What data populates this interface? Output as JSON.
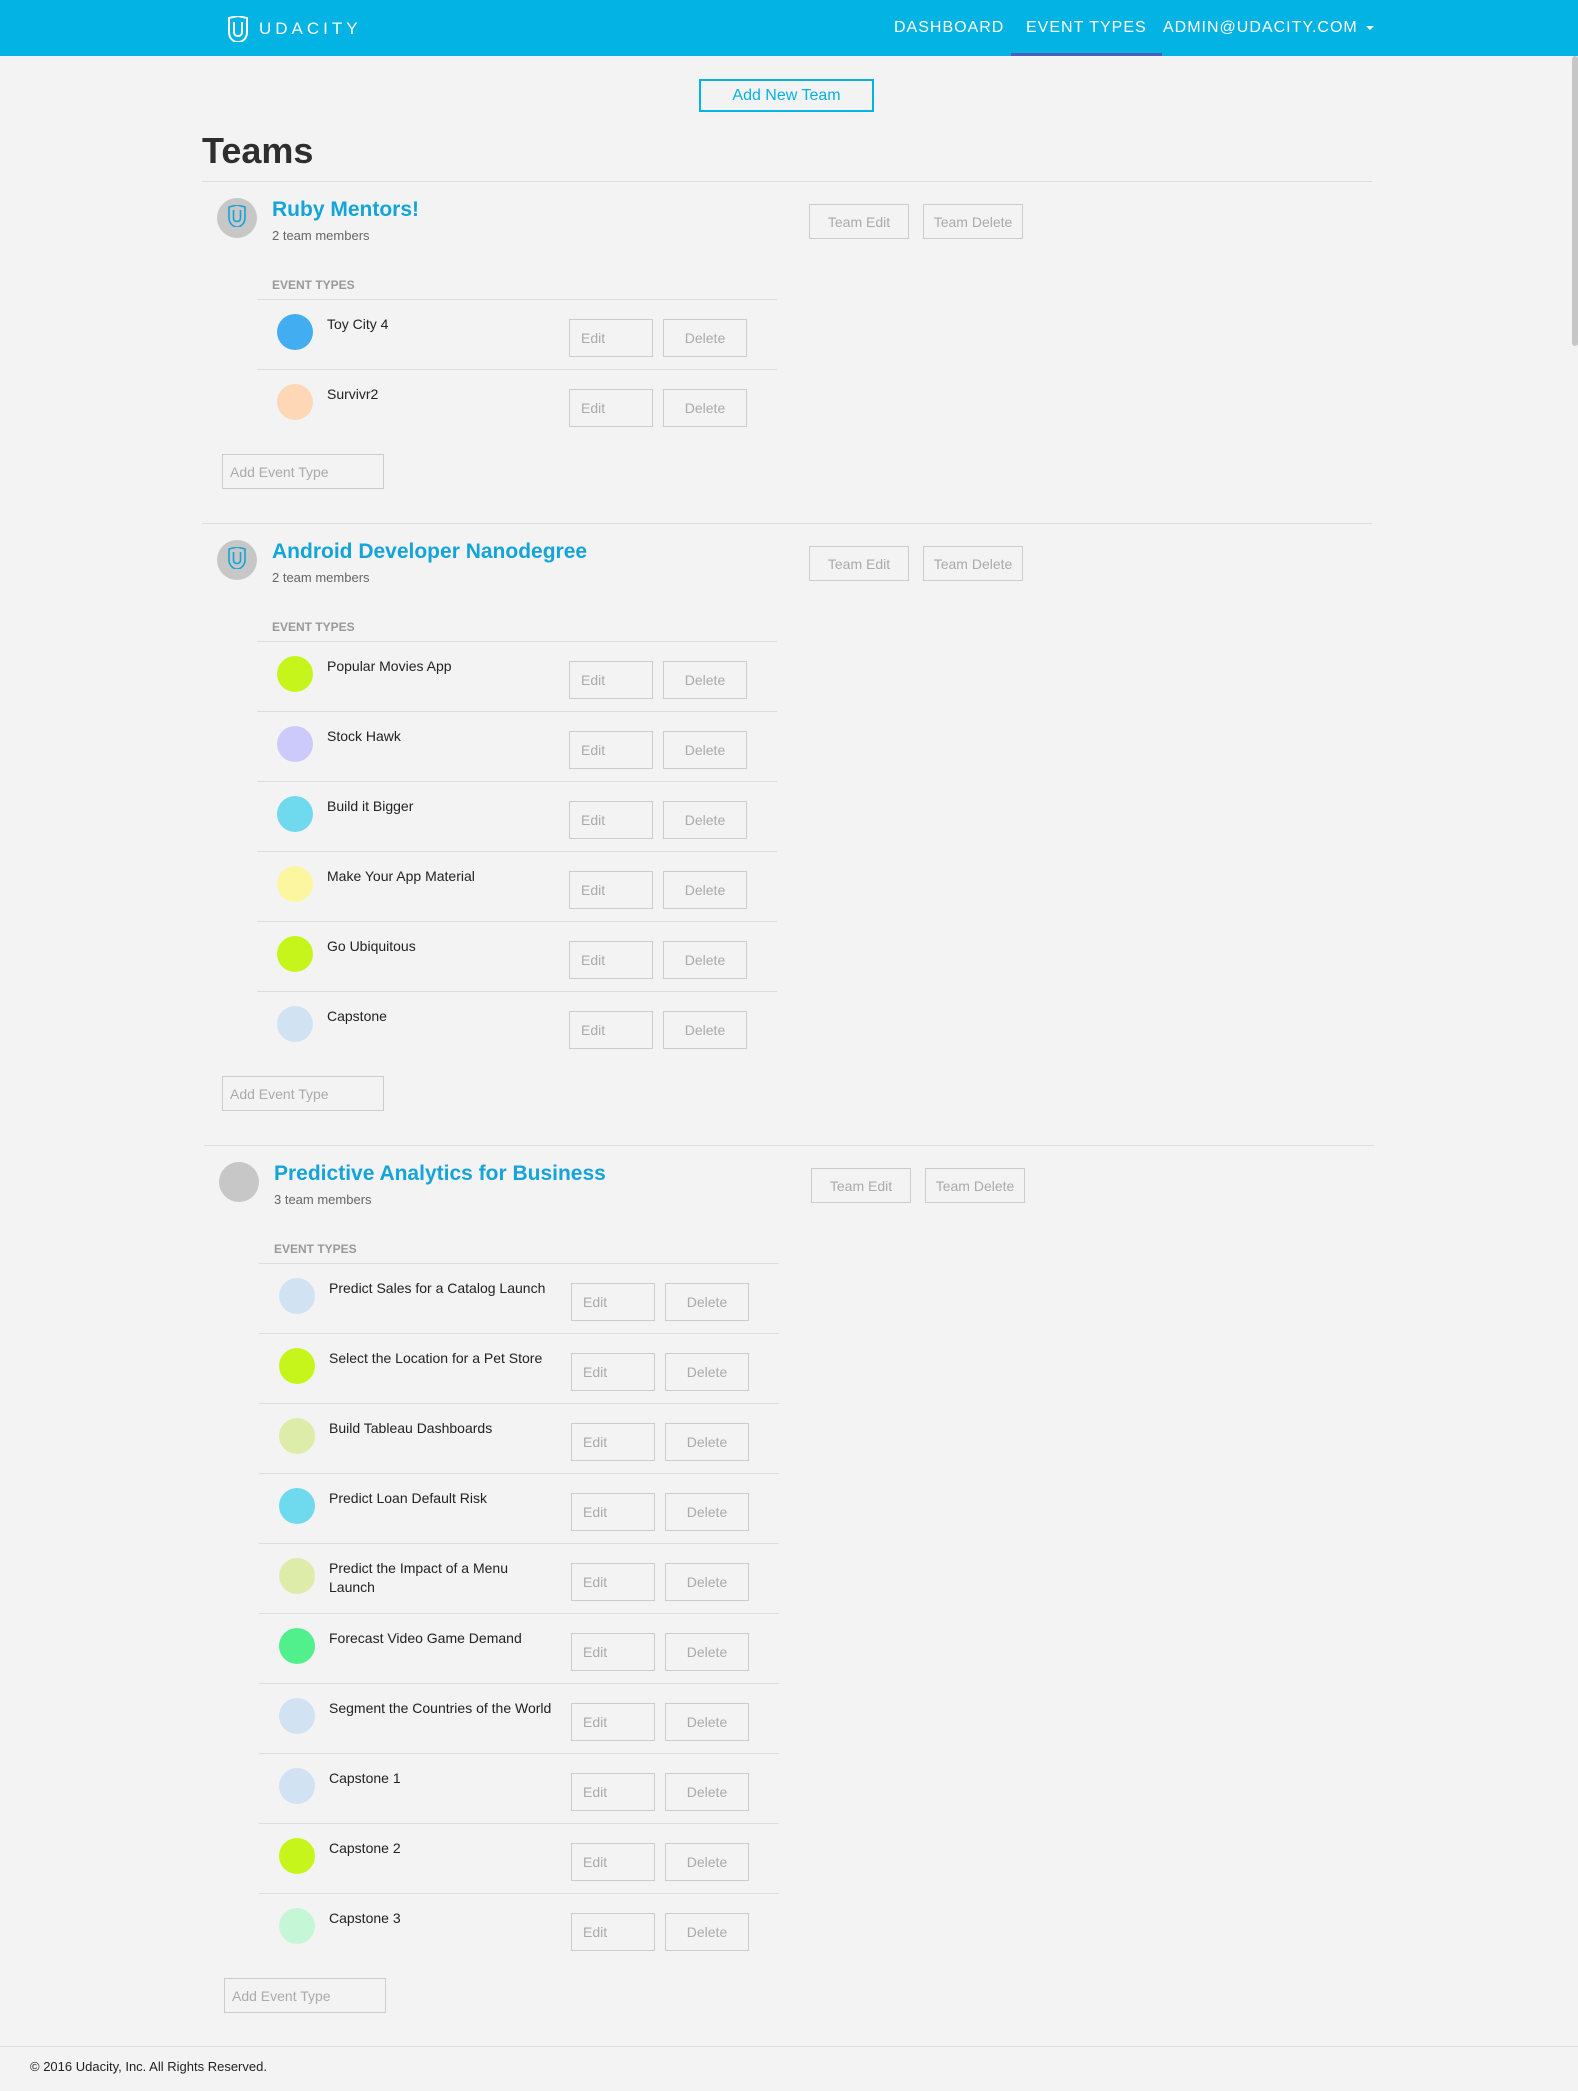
{
  "nav": {
    "brand": "UDACITY",
    "items": [
      "DASHBOARD",
      "EVENT TYPES"
    ],
    "user": "ADMIN@UDACITY.COM"
  },
  "add_team_label": "Add New Team",
  "page_title": "Teams",
  "labels": {
    "team_edit": "Team Edit",
    "team_delete": "Team Delete",
    "event_types": "EVENT TYPES",
    "edit": "Edit",
    "delete": "Delete",
    "add_event_type_placeholder": "Add Event Type"
  },
  "teams": [
    {
      "name": "Ruby Mentors!",
      "members": "2 team members",
      "avatar": "udacity-logo-icon",
      "event_types": [
        {
          "name": "Toy City 4",
          "color": "#42adf0"
        },
        {
          "name": "Survivr2",
          "color": "#fdd7b6"
        }
      ]
    },
    {
      "name": "Android Developer Nanodegree",
      "members": "2 team members",
      "avatar": "udacity-logo-icon",
      "event_types": [
        {
          "name": "Popular Movies App",
          "color": "#c6f51c"
        },
        {
          "name": "Stock Hawk",
          "color": "#cccafa"
        },
        {
          "name": "Build it Bigger",
          "color": "#6fd9ee"
        },
        {
          "name": "Make Your App Material",
          "color": "#fdf6a0"
        },
        {
          "name": "Go Ubiquitous",
          "color": "#c6f51c"
        },
        {
          "name": "Capstone",
          "color": "#d1e2f3"
        }
      ]
    },
    {
      "name": "Predictive Analytics for Business",
      "members": "3 team members",
      "avatar": "",
      "event_types": [
        {
          "name": "Predict Sales for a Catalog Launch",
          "color": "#d1e2f3"
        },
        {
          "name": "Select the Location for a Pet Store",
          "color": "#c6f51c"
        },
        {
          "name": "Build Tableau Dashboards",
          "color": "#ddeca8"
        },
        {
          "name": "Predict Loan Default Risk",
          "color": "#6fd9ee"
        },
        {
          "name": "Predict the Impact of a Menu Launch",
          "color": "#ddeca8"
        },
        {
          "name": "Forecast Video Game Demand",
          "color": "#52f08c"
        },
        {
          "name": "Segment the Countries of the World",
          "color": "#d1e2f3"
        },
        {
          "name": "Capstone 1",
          "color": "#d1e2f3"
        },
        {
          "name": "Capstone 2",
          "color": "#c6f51c"
        },
        {
          "name": "Capstone 3",
          "color": "#c5f7d6"
        }
      ]
    }
  ],
  "footer": "© 2016 Udacity, Inc. All Rights Reserved."
}
